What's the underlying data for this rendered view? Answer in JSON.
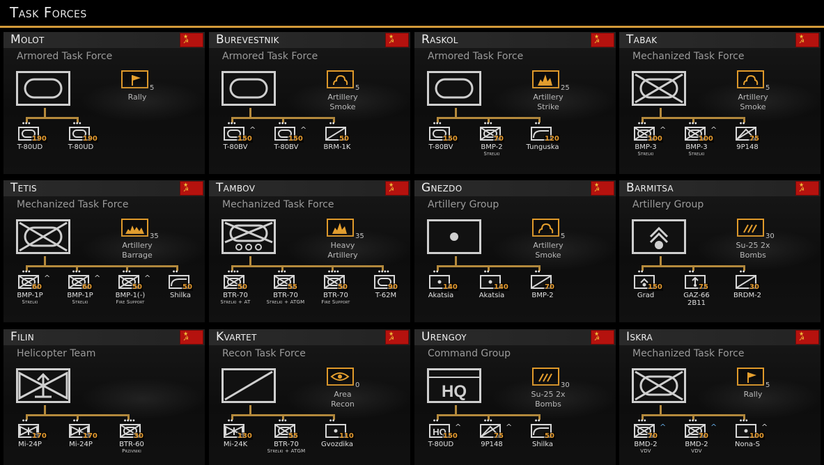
{
  "page_title": "Task Forces",
  "colors": {
    "accent": "#d39a3a",
    "value": "#e49a2e",
    "flag": "#b5120e"
  },
  "cards": [
    {
      "name": "Molot",
      "type": "Armored Task Force",
      "symbol": "armor",
      "ability": {
        "name": "Rally",
        "icon": "rally-flag-icon",
        "count": "5"
      },
      "units": [
        {
          "name": "T-80UD",
          "sub": "",
          "value": "190",
          "pips": "•••",
          "symbol": "armor"
        },
        {
          "name": "T-80UD",
          "sub": "",
          "value": "190",
          "pips": "•••",
          "symbol": "armor"
        }
      ]
    },
    {
      "name": "Burevestnik",
      "type": "Armored Task Force",
      "symbol": "armor",
      "ability": {
        "name": "Artillery Smoke",
        "icon": "smoke-icon",
        "count": "5"
      },
      "units": [
        {
          "name": "T-80BV",
          "sub": "",
          "value": "150",
          "pips": "•••",
          "symbol": "armor",
          "chev": "^"
        },
        {
          "name": "T-80BV",
          "sub": "",
          "value": "150",
          "pips": "•••",
          "symbol": "armor",
          "chev": "^"
        },
        {
          "name": "BRM-1K",
          "sub": "",
          "value": "50",
          "pips": "••",
          "symbol": "recon"
        }
      ]
    },
    {
      "name": "Raskol",
      "type": "Armored Task Force",
      "symbol": "armor",
      "ability": {
        "name": "Artillery Strike",
        "icon": "explosion-icon",
        "count": "25"
      },
      "units": [
        {
          "name": "T-80BV",
          "sub": "",
          "value": "150",
          "pips": "•••",
          "symbol": "armor"
        },
        {
          "name": "BMP-2",
          "sub": "Strelki",
          "value": "70",
          "pips": "•••",
          "symbol": "mech"
        },
        {
          "name": "Tunguska",
          "sub": "",
          "value": "120",
          "pips": "••",
          "symbol": "aa"
        }
      ]
    },
    {
      "name": "Tabak",
      "type": "Mechanized Task Force",
      "symbol": "mech",
      "ability": {
        "name": "Artillery Smoke",
        "icon": "smoke-icon",
        "count": "5"
      },
      "units": [
        {
          "name": "BMP-3",
          "sub": "Strelki",
          "value": "100",
          "pips": "•••",
          "symbol": "mech",
          "chev": "^"
        },
        {
          "name": "BMP-3",
          "sub": "Strelki",
          "value": "100",
          "pips": "•••",
          "symbol": "mech",
          "chev": "^"
        },
        {
          "name": "9P148",
          "sub": "",
          "value": "75",
          "pips": "••",
          "symbol": "at"
        }
      ]
    },
    {
      "name": "Tetis",
      "type": "Mechanized Task Force",
      "symbol": "mech",
      "ability": {
        "name": "Artillery Barrage",
        "icon": "barrage-icon",
        "count": "35"
      },
      "units": [
        {
          "name": "BMP-1P",
          "sub": "Strelki",
          "value": "60",
          "pips": "•••",
          "symbol": "mech",
          "chev": "^"
        },
        {
          "name": "BMP-1P",
          "sub": "Strelki",
          "value": "60",
          "pips": "•••",
          "symbol": "mech",
          "chev": "^"
        },
        {
          "name": "BMP-1(-)",
          "sub": "Fire Support",
          "value": "50",
          "pips": "•••",
          "symbol": "mech",
          "chev": "^"
        },
        {
          "name": "Shilka",
          "sub": "",
          "value": "50",
          "pips": "••",
          "symbol": "aa"
        }
      ]
    },
    {
      "name": "Tambov",
      "type": "Mechanized Task Force",
      "symbol": "mech-wheeled",
      "ability": {
        "name": "Heavy Artillery",
        "icon": "explosion-icon",
        "count": "35"
      },
      "units": [
        {
          "name": "BTR-70",
          "sub": "Strelki + AT",
          "value": "50",
          "pips": "••••",
          "symbol": "mech"
        },
        {
          "name": "BTR-70",
          "sub": "Strelki + ATGM",
          "value": "55",
          "pips": "•••",
          "symbol": "mech"
        },
        {
          "name": "BTR-70",
          "sub": "Fire Support",
          "value": "50",
          "pips": "••••",
          "symbol": "mech"
        },
        {
          "name": "T-62M",
          "sub": "",
          "value": "90",
          "pips": "••••",
          "symbol": "armor"
        }
      ]
    },
    {
      "name": "Gnezdo",
      "type": "Artillery Group",
      "symbol": "artillery",
      "ability": {
        "name": "Artillery Smoke",
        "icon": "smoke-icon",
        "count": "5"
      },
      "units": [
        {
          "name": "Akatsia",
          "sub": "",
          "value": "140",
          "pips": "••",
          "symbol": "artillery"
        },
        {
          "name": "Akatsia",
          "sub": "",
          "value": "140",
          "pips": "••",
          "symbol": "artillery"
        },
        {
          "name": "BMP-2",
          "sub": "",
          "value": "70",
          "pips": "••",
          "symbol": "recon"
        }
      ]
    },
    {
      "name": "Barmitsa",
      "type": "Artillery Group",
      "symbol": "rocket",
      "ability": {
        "name": "Su-25 2x Bombs",
        "icon": "bombs-icon",
        "count": "30"
      },
      "units": [
        {
          "name": "Grad",
          "sub": "",
          "value": "150",
          "pips": "••",
          "symbol": "rocket"
        },
        {
          "name": "GAZ-66 2B11",
          "sub": "",
          "value": "75",
          "pips": "••",
          "symbol": "mortar"
        },
        {
          "name": "BRDM-2",
          "sub": "",
          "value": "30",
          "pips": "••",
          "symbol": "recon"
        }
      ]
    },
    {
      "name": "Filin",
      "type": "Helicopter Team",
      "symbol": "heli",
      "ability": {
        "name": "",
        "icon": "",
        "count": ""
      },
      "units": [
        {
          "name": "Mi-24P",
          "sub": "",
          "value": "170",
          "pips": "••",
          "symbol": "heli"
        },
        {
          "name": "Mi-24P",
          "sub": "",
          "value": "170",
          "pips": "••",
          "symbol": "heli"
        },
        {
          "name": "BTR-60",
          "sub": "Przivniki",
          "value": "30",
          "pips": "••••",
          "symbol": "mech"
        }
      ]
    },
    {
      "name": "Kvartet",
      "type": "Recon Task Force",
      "symbol": "recon",
      "ability": {
        "name": "Area Recon",
        "icon": "eye-icon",
        "count": "0"
      },
      "units": [
        {
          "name": "Mi-24K",
          "sub": "",
          "value": "130",
          "pips": "••",
          "symbol": "heli"
        },
        {
          "name": "BTR-70",
          "sub": "Strelki + ATGM",
          "value": "55",
          "pips": "•••",
          "symbol": "mech"
        },
        {
          "name": "Gvozdika",
          "sub": "",
          "value": "110",
          "pips": "••",
          "symbol": "artillery"
        }
      ]
    },
    {
      "name": "Urengoy",
      "type": "Command Group",
      "symbol": "hq",
      "ability": {
        "name": "Su-25 2x Bombs",
        "icon": "bombs-icon",
        "count": "30"
      },
      "units": [
        {
          "name": "T-80UD",
          "sub": "",
          "value": "150",
          "pips": "••",
          "symbol": "hq",
          "chev": "^"
        },
        {
          "name": "9P148",
          "sub": "",
          "value": "75",
          "pips": "•••",
          "symbol": "at",
          "chev": "^"
        },
        {
          "name": "Shilka",
          "sub": "",
          "value": "50",
          "pips": "••",
          "symbol": "aa"
        }
      ]
    },
    {
      "name": "Iskra",
      "type": "Mechanized Task Force",
      "symbol": "mech",
      "ability": {
        "name": "Rally",
        "icon": "rally-flag-icon",
        "count": "5"
      },
      "units": [
        {
          "name": "BMD-2",
          "sub": "VDV",
          "value": "70",
          "pips": "•••",
          "symbol": "mech",
          "chev": "^",
          "chev_blue": true
        },
        {
          "name": "BMD-2",
          "sub": "VDV",
          "value": "70",
          "pips": "•••",
          "symbol": "mech",
          "chev": "^",
          "chev_blue": true
        },
        {
          "name": "Nona-S",
          "sub": "",
          "value": "100",
          "pips": "•••",
          "symbol": "artillery",
          "chev": "^"
        }
      ]
    }
  ]
}
